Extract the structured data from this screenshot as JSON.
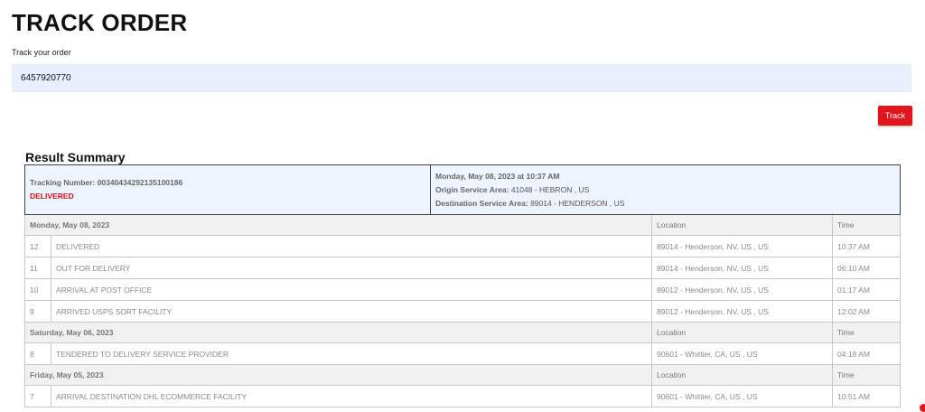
{
  "header": {
    "title": "TRACK ORDER",
    "input_label": "Track your order"
  },
  "search": {
    "value": "6457920770",
    "button_label": "Track"
  },
  "summary": {
    "title": "Result Summary",
    "tracking_label": "Tracking Number:",
    "tracking_number": "00340434292135100186",
    "status": "DELIVERED",
    "datetime": "Monday, May 08, 2023 at 10:37 AM",
    "origin_label": "Origin Service Area:",
    "origin": "41048 - HEBRON , US",
    "destination_label": "Destination Service Area:",
    "destination": "89014 - HENDERSON , US"
  },
  "history": {
    "location_header": "Location",
    "time_header": "Time",
    "days": [
      {
        "date": "Monday, May 08, 2023",
        "events": [
          {
            "num": "12",
            "desc": "DELIVERED",
            "location": "89014 - Henderson, NV, US , US",
            "time": "10:37 AM"
          },
          {
            "num": "11",
            "desc": "OUT FOR DELIVERY",
            "location": "89014 - Henderson, NV, US , US",
            "time": "06:10 AM"
          },
          {
            "num": "10",
            "desc": "ARRIVAL AT POST OFFICE",
            "location": "89012 - Henderson, NV, US , US",
            "time": "01:17 AM"
          },
          {
            "num": "9",
            "desc": "ARRIVED USPS SORT FACILITY",
            "location": "89012 - Henderson, NV, US , US",
            "time": "12:02 AM"
          }
        ]
      },
      {
        "date": "Saturday, May 06, 2023",
        "events": [
          {
            "num": "8",
            "desc": "TENDERED TO DELIVERY SERVICE PROVIDER",
            "location": "90601 - Whittier, CA, US , US",
            "time": "04:18 AM"
          }
        ]
      },
      {
        "date": "Friday, May 05, 2023",
        "events": [
          {
            "num": "7",
            "desc": "ARRIVAL DESTINATION DHL ECOMMERCE FACILITY",
            "location": "90601 - Whittier, CA, US , US",
            "time": "10:51 AM"
          }
        ]
      }
    ]
  },
  "colors": {
    "accent": "#e3151c",
    "input_bg": "#e8f0fe",
    "summary_bg": "#eef4fd"
  }
}
